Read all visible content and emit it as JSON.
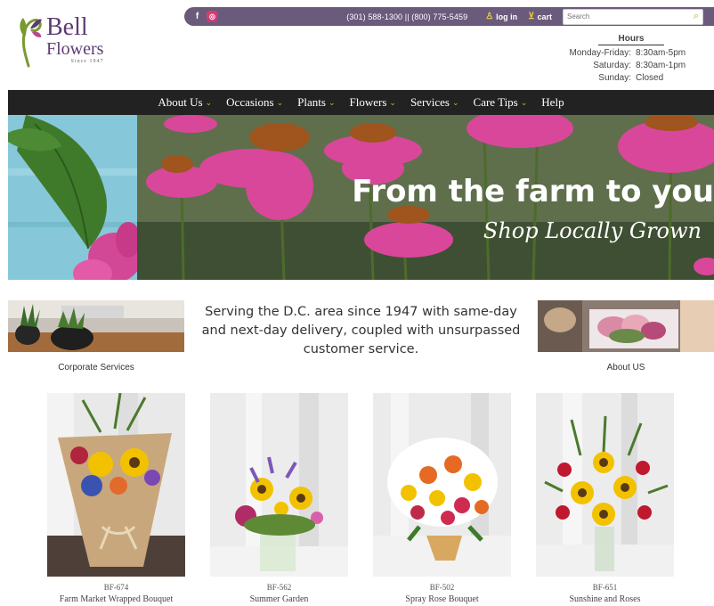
{
  "brand": {
    "name_line1": "Bell",
    "name_line2": "Flowers",
    "since": "Since 1947"
  },
  "topbar": {
    "facebook_icon": "f",
    "instagram_icon": "◎",
    "phones": "(301) 588-1300  ||  (800) 775-5459",
    "login_label": "log in",
    "cart_label": "cart",
    "search_placeholder": "Search"
  },
  "hours": {
    "title": "Hours",
    "rows": [
      {
        "days": "Monday-Friday:",
        "time": "8:30am-5pm"
      },
      {
        "days": "Saturday:",
        "time": "8:30am-1pm"
      },
      {
        "days": "Sunday:",
        "time": "Closed"
      }
    ]
  },
  "nav": {
    "items": [
      {
        "label": "About Us",
        "has_dropdown": true
      },
      {
        "label": "Occasions",
        "has_dropdown": true
      },
      {
        "label": "Plants",
        "has_dropdown": true
      },
      {
        "label": "Flowers",
        "has_dropdown": true
      },
      {
        "label": "Services",
        "has_dropdown": true
      },
      {
        "label": "Care Tips",
        "has_dropdown": true
      },
      {
        "label": "Help",
        "has_dropdown": false
      }
    ],
    "chevron": "⌄"
  },
  "hero": {
    "headline": "From the farm to you",
    "subline": "Shop Locally Grown"
  },
  "intro": {
    "left_caption": "Corporate Services",
    "right_caption": "About US",
    "text": "Serving the D.C. area since 1947 with same-day and next-day delivery, coupled with unsurpassed customer service."
  },
  "products": [
    {
      "code": "BF-674",
      "name": "Farm Market Wrapped Bouquet"
    },
    {
      "code": "BF-562",
      "name": "Summer Garden"
    },
    {
      "code": "BF-502",
      "name": "Spray Rose Bouquet"
    },
    {
      "code": "BF-651",
      "name": "Sunshine and Roses"
    }
  ],
  "colors": {
    "topbar": "#6a5a7c",
    "nav": "#222222",
    "accent_green": "#a8c84a",
    "brand_purple": "#5b3b74",
    "coneflower_pink": "#d9479a"
  }
}
